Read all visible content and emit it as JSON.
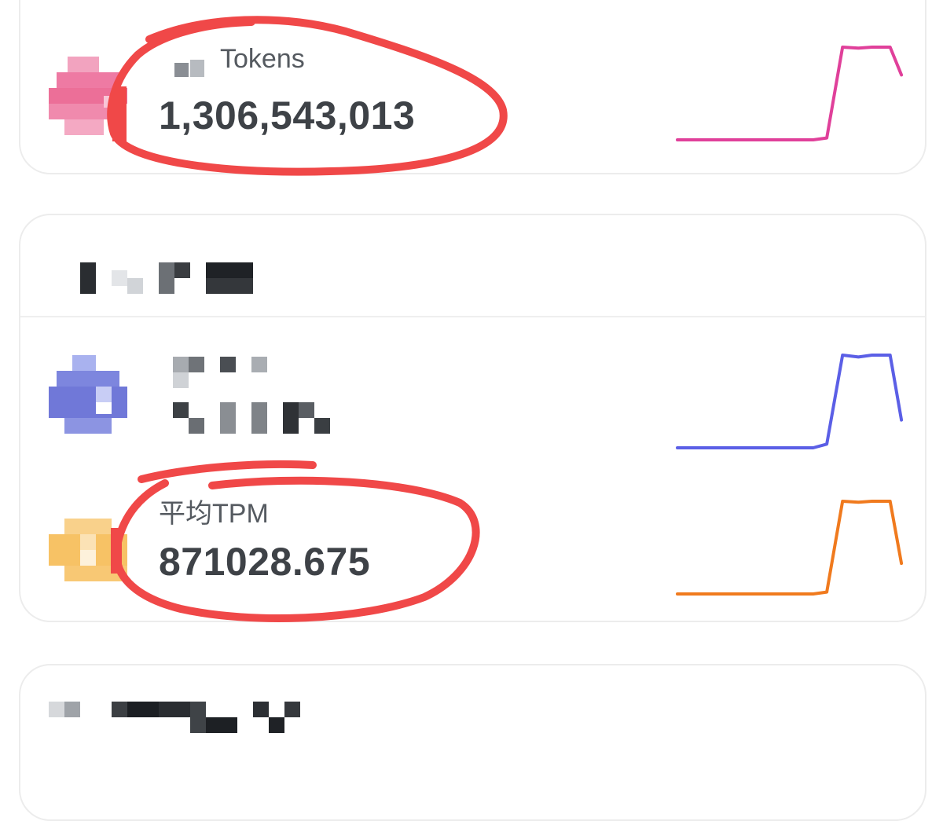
{
  "stats": [
    {
      "id": "tokens",
      "label": "Tokens",
      "value": "1,306,543,013",
      "color": "#e0409a",
      "icon": "token-icon",
      "sparkline": [
        0,
        0,
        0,
        0,
        0,
        0,
        0,
        0.02,
        1,
        0.99,
        1,
        1,
        0.7
      ]
    },
    {
      "id": "obscured-metric",
      "label": "",
      "value": "",
      "color": "#5b5fe6",
      "icon": "requests-icon",
      "sparkline": [
        0,
        0,
        0,
        0,
        0,
        0,
        0,
        0.04,
        1,
        0.98,
        1,
        1,
        0.3
      ]
    },
    {
      "id": "tpm",
      "label": "平均TPM",
      "value": "871028.675",
      "color": "#f07a1e",
      "icon": "tpm-icon",
      "sparkline": [
        0,
        0,
        0,
        0,
        0,
        0,
        0,
        0.02,
        1,
        0.99,
        1,
        1,
        0.33
      ]
    }
  ],
  "colors": {
    "annotation": "#f04848",
    "card_border": "#ececec",
    "value_text": "#3e4247"
  }
}
